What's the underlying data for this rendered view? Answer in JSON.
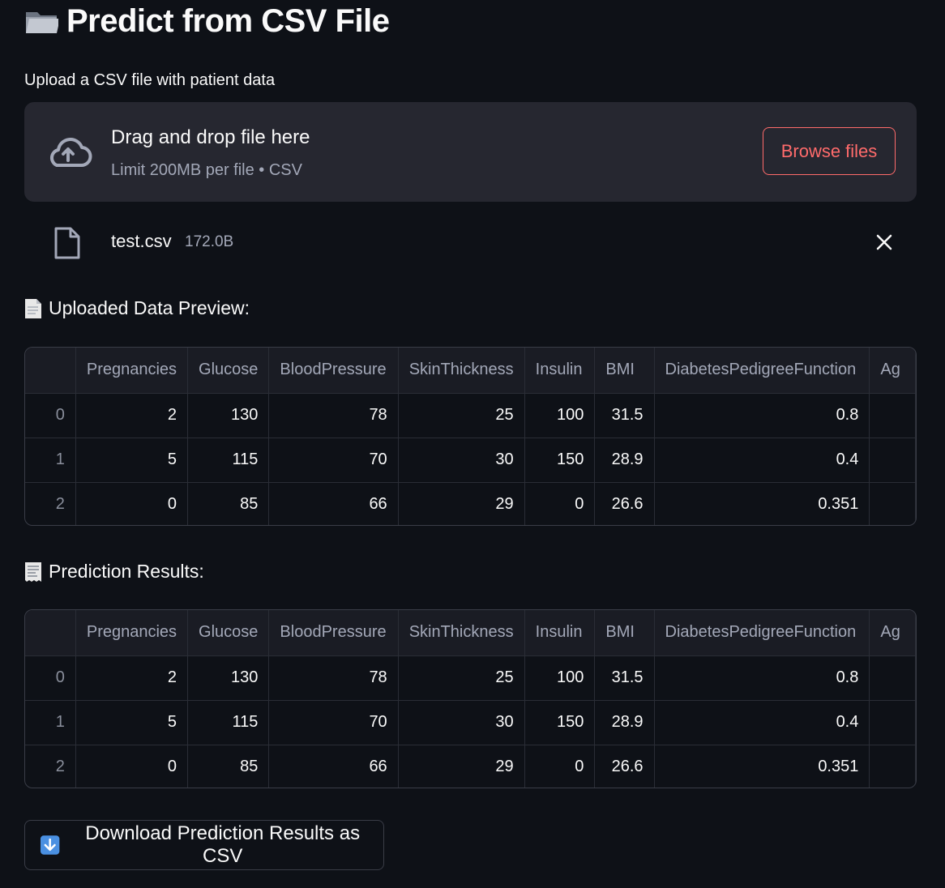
{
  "page": {
    "title": "Predict from CSV File",
    "title_icon": "folder-icon"
  },
  "uploader": {
    "label": "Upload a CSV file with patient data",
    "drop_text": "Drag and drop file here",
    "limit_text": "Limit 200MB per file • CSV",
    "browse_label": "Browse files",
    "icon": "cloud-upload-icon"
  },
  "uploaded_file": {
    "name": "test.csv",
    "size": "172.0B",
    "icon": "file-icon",
    "remove_icon": "close-icon"
  },
  "preview": {
    "heading": "Uploaded Data Preview:",
    "icon": "document-icon",
    "columns": [
      "",
      "Pregnancies",
      "Glucose",
      "BloodPressure",
      "SkinThickness",
      "Insulin",
      "BMI",
      "DiabetesPedigreeFunction",
      "Ag"
    ],
    "rows": [
      [
        "0",
        "2",
        "130",
        "78",
        "25",
        "100",
        "31.5",
        "0.8",
        ""
      ],
      [
        "1",
        "5",
        "115",
        "70",
        "30",
        "150",
        "28.9",
        "0.4",
        ""
      ],
      [
        "2",
        "0",
        "85",
        "66",
        "29",
        "0",
        "26.6",
        "0.351",
        ""
      ]
    ]
  },
  "results": {
    "heading": "Prediction Results:",
    "icon": "receipt-icon",
    "columns": [
      "",
      "Pregnancies",
      "Glucose",
      "BloodPressure",
      "SkinThickness",
      "Insulin",
      "BMI",
      "DiabetesPedigreeFunction",
      "Ag"
    ],
    "rows": [
      [
        "0",
        "2",
        "130",
        "78",
        "25",
        "100",
        "31.5",
        "0.8",
        ""
      ],
      [
        "1",
        "5",
        "115",
        "70",
        "30",
        "150",
        "28.9",
        "0.4",
        ""
      ],
      [
        "2",
        "0",
        "85",
        "66",
        "29",
        "0",
        "26.6",
        "0.351",
        ""
      ]
    ]
  },
  "download": {
    "label": "Download Prediction Results as CSV",
    "icon": "down-arrow-icon"
  },
  "colors": {
    "background": "#0e1117",
    "panel": "#262730",
    "accent": "#ff6b6b",
    "muted_text": "#a3a8b8"
  }
}
